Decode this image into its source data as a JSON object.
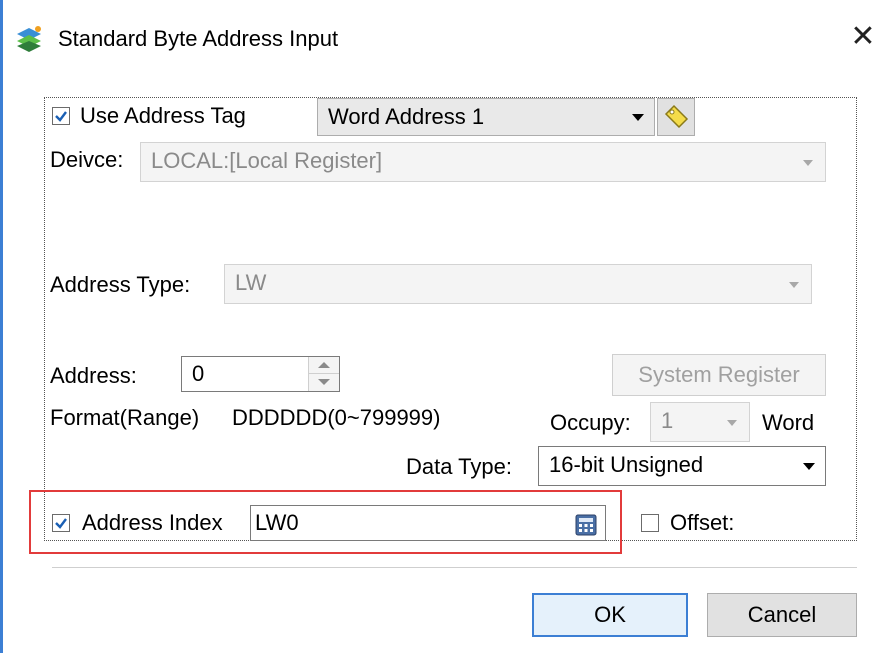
{
  "window": {
    "title": "Standard Byte Address Input",
    "close_glyph": "✕"
  },
  "use_address_tag": {
    "label": "Use Address Tag",
    "checked": true,
    "tag_value": "Word Address 1"
  },
  "device": {
    "label": "Deivce:",
    "value": "LOCAL:[Local Register]"
  },
  "address_type": {
    "label": "Address Type:",
    "value": "LW"
  },
  "address": {
    "label": "Address:",
    "value": "0",
    "system_register_label": "System Register"
  },
  "format": {
    "label": "Format(Range)",
    "range": "DDDDDD(0~799999)"
  },
  "occupy": {
    "label": "Occupy:",
    "value": "1",
    "unit": "Word"
  },
  "data_type": {
    "label": "Data Type:",
    "value": "16-bit Unsigned"
  },
  "address_index": {
    "label": "Address Index",
    "checked": true,
    "value": "LW0"
  },
  "offset": {
    "label": "Offset:",
    "checked": false
  },
  "buttons": {
    "ok": "OK",
    "cancel": "Cancel"
  },
  "colors": {
    "accent": "#3c7fd4",
    "highlight_box": "#e23b3b"
  }
}
